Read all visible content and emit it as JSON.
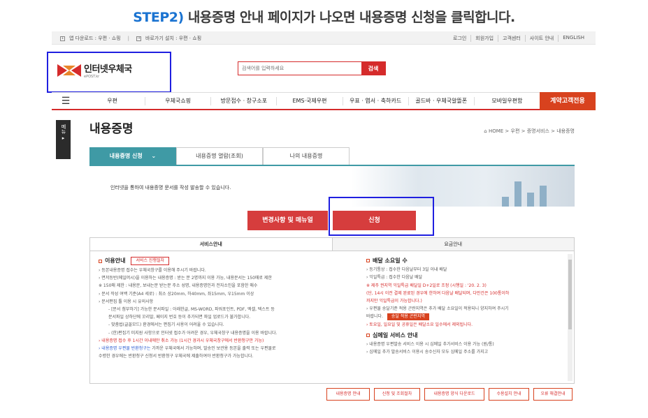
{
  "step": {
    "num": "STEP2)",
    "text": "내용증명 안내 페이지가 나오면 내용증명 신청을 클릭합니다."
  },
  "util": {
    "left": [
      "앱 다운로드 : 우편 · 쇼핑",
      "바로가기 설치 : 우편 · 쇼핑"
    ],
    "right": [
      "로그인",
      "회원가입",
      "고객센터",
      "사이트 안내",
      "ENGLISH"
    ]
  },
  "logo": {
    "title": "인터넷우체국",
    "sub": "ePOST.kr"
  },
  "search": {
    "placeholder": "검색어를 입력하세요",
    "button": "검색"
  },
  "nav": {
    "items": [
      "우편",
      "우체국쇼핑",
      "방문접수 · 창구소포",
      "EMS·국제우편",
      "우표 · 엽서 · 축하카드",
      "골드바 · 우체국알뜰폰",
      "모바일우편함"
    ],
    "special": "계약고객전용"
  },
  "side_tab": "메뉴",
  "page": {
    "title": "내용증명",
    "breadcrumb": "⌂ HOME  >  우편  >  증명서비스  >  내용증명"
  },
  "tabs": [
    "내용증명 신청",
    "내용증명 열람(조회)",
    "나의 내용증명"
  ],
  "banner": {
    "text": "인터넷을 통하여 내용증명 문서를 작성 발송할 수 있습니다."
  },
  "actions": {
    "manual": "변경사항 및 매뉴얼",
    "apply": "신청"
  },
  "info_tabs": [
    "서비스안내",
    "요금안내"
  ],
  "left_col": {
    "title": "이용안내",
    "tag": "서비스 진행절차",
    "lines": [
      "› 등본내용증명 접수는 우체국창구를 이용해 주시기 바랍니다.",
      "› 면저등반(메일머시)을 이용하는 내용증명 : 받는 분 2명까지 이용 가능, 내용문서는 150매로 제한",
      "  ※ 150매 제한 : 내용문, 보내는분 받는분 주소 성명, 내용증명인과 전자소인을 포함한 매수",
      "› 문서 작성 여백 기준(A4 세로) : 최소 상20mm, 하40mm, 좌15mm, 우15mm 이상",
      "› 문서편집 툴 이용 시 유의사항"
    ],
    "sub_lines": [
      "- [문서 첨부하기] 가능한 문서파일 : 아래한글, MS-WORD, 파워포인트, PDF, 엑셀, 텍스트 등",
      "  문서파일 상하단에 꼬리말, 페이지 번호 등이 추가되면 파일 업로드가 불가합니다.",
      "- 맞춤법(글꼴모드) 환경에서는 편집기 사용이 어려울 수 있습니다.",
      "- (한)편집기 미지원 사항으로 인터넷 접수가 어려운 경우, 우체국창구 내용증명을 이용 바랍니다."
    ],
    "red_line": "› 내용증명 접수 후 1시간 이내에만 취소 가능 (1시간 경과시 우체국창구에서 반환청구만 가능)",
    "blue_line_a": "› 내용증명 우편물 반환청구는",
    "blue_line_b": " 가까운 우체국에서 가능하며, 발송인 보관용 등본을 출력 또는 우편물로",
    "last_line": "  수령한 경우에는 반환청구 신청서 반환청구 우체국에 제출하여야 반환청구가 가능합니다."
  },
  "right_col": {
    "title1": "배달 소요일 수",
    "lines1": [
      "› 등기통상 : 접수한 다음날부터 3일 이내 배달",
      "› 익일특급 : 접수한 다음날 배달"
    ],
    "red_lines": [
      "  ※ 제주 권지역 익일특급 배달일 D+2일로 조정 (시행일 : '20. 2. 3)",
      "  (단, 14시 이전 결제 완료된 경우에 한하여 다음날 배달되며, 다만건은 100통이하",
      "  까지만 익일특급이 가능합니다.)"
    ],
    "note": "› 우편물 송달기준 적용 곤란지역은 추가 배달 소요일이 적용되니 양지하여 주시기",
    "note2": "  바랍니다.",
    "chip": "송달 적용 곤란지역",
    "holiday": "› 토요일, 일요일 및 공휴일은 배달소요 일수에서 제외됩니다.",
    "title2": "심메일 서비스 안내",
    "lines2": [
      "› 내용증명 우편발송 서비스 이용 시 심메일 추가서비스 이용 가능 (원/통)",
      "› 심메일 추가 발송서비스 이용시 송수신자 모두 심메일 주소를 가지고"
    ]
  },
  "bottom_buttons": [
    "내용증명 안내",
    "신청 및 조회절차",
    "내용증명 양식 다운로드",
    "수용설치 안내",
    "오류 해결안내"
  ],
  "colors": {
    "accent_red": "#d52b2b",
    "teal": "#3f9aa5",
    "highlight_blue": "#1f1fe0",
    "step_blue": "#1a73d1"
  }
}
